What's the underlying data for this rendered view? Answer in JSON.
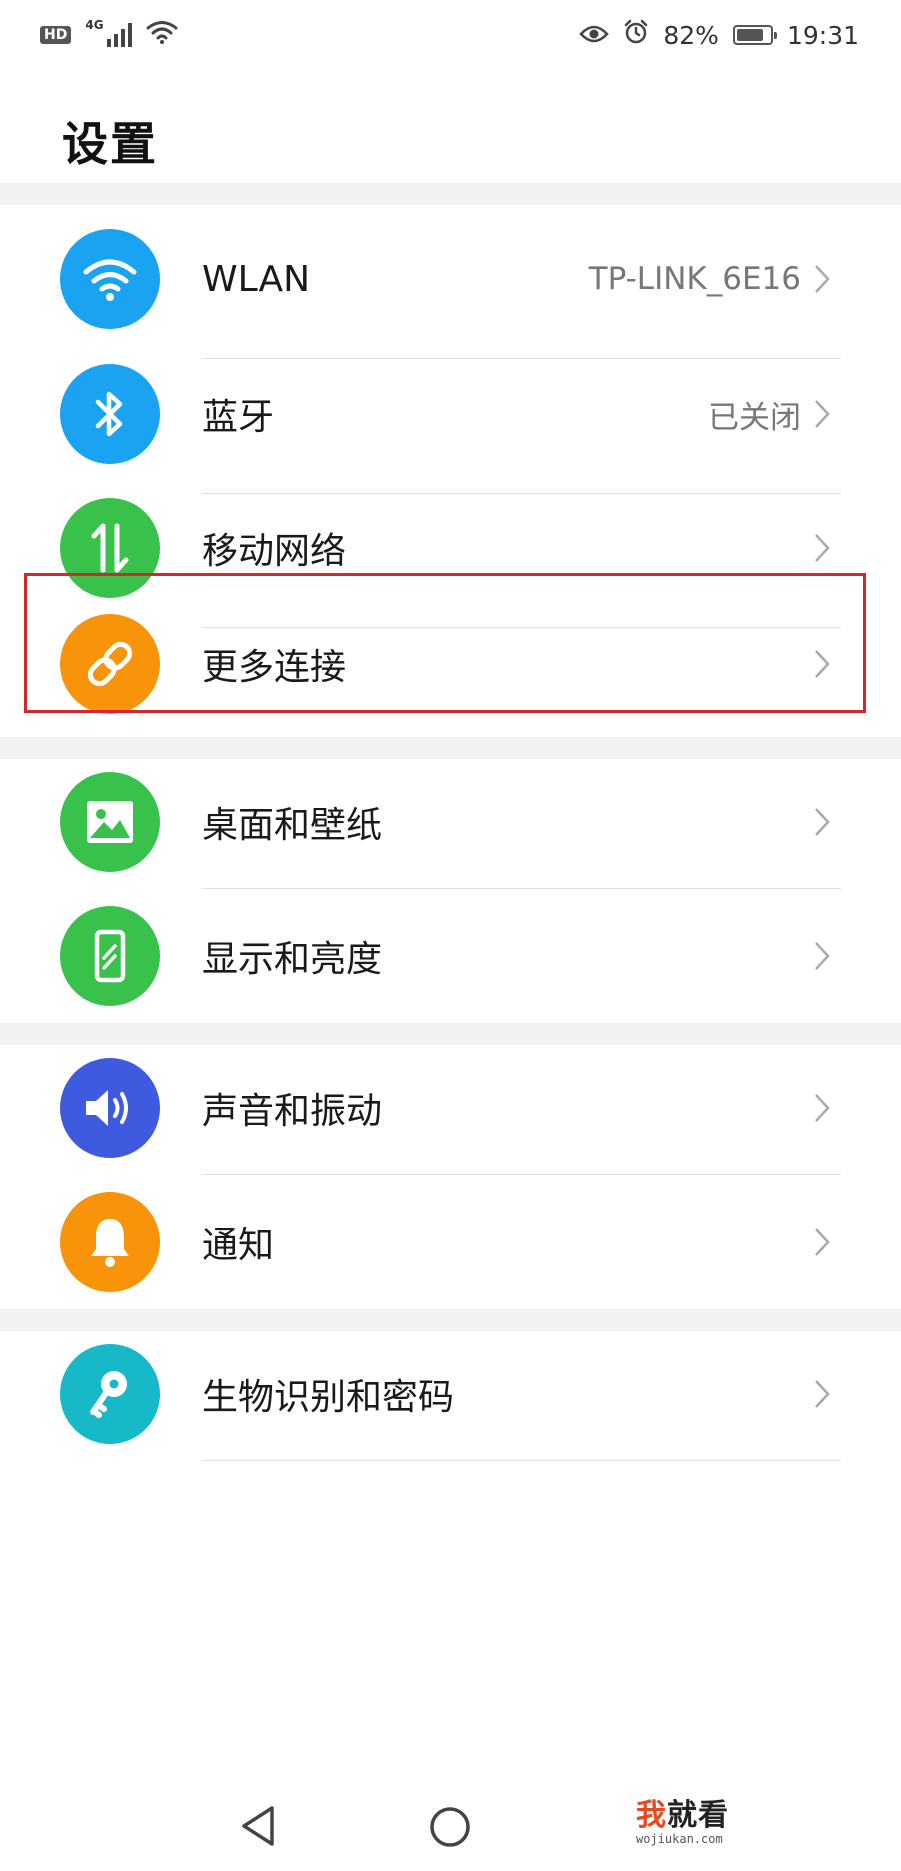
{
  "status_bar": {
    "hd": "HD",
    "network": "4G",
    "battery_percent": "82%",
    "battery_level": 0.82,
    "time": "19:31"
  },
  "page": {
    "title": "设置"
  },
  "items": [
    {
      "id": "wlan",
      "label": "WLAN",
      "value": "TP-LINK_6E16",
      "icon": "wifi-icon",
      "color": "#1aa3f0"
    },
    {
      "id": "bluetooth",
      "label": "蓝牙",
      "value": "已关闭",
      "icon": "bluetooth-icon",
      "color": "#1aa3f0"
    },
    {
      "id": "mobile-network",
      "label": "移动网络",
      "value": "",
      "icon": "mobile-data-icon",
      "color": "#39c24b"
    },
    {
      "id": "more-connections",
      "label": "更多连接",
      "value": "",
      "icon": "link-icon",
      "color": "#f7940a"
    },
    {
      "id": "home-wallpaper",
      "label": "桌面和壁纸",
      "value": "",
      "icon": "image-icon",
      "color": "#39c24b"
    },
    {
      "id": "display-brightness",
      "label": "显示和亮度",
      "value": "",
      "icon": "phone-display-icon",
      "color": "#39c24b"
    },
    {
      "id": "sound-vibration",
      "label": "声音和振动",
      "value": "",
      "icon": "speaker-icon",
      "color": "#3e5be0"
    },
    {
      "id": "notifications",
      "label": "通知",
      "value": "",
      "icon": "bell-icon",
      "color": "#f7940a"
    },
    {
      "id": "biometrics-password",
      "label": "生物识别和密码",
      "value": "",
      "icon": "key-icon",
      "color": "#17b8c8"
    }
  ],
  "highlighted_item": "mobile-network",
  "highlight_color": "#d0282e",
  "watermark": {
    "accent": "我",
    "main": "就看",
    "sub": "wojiukan.com"
  }
}
